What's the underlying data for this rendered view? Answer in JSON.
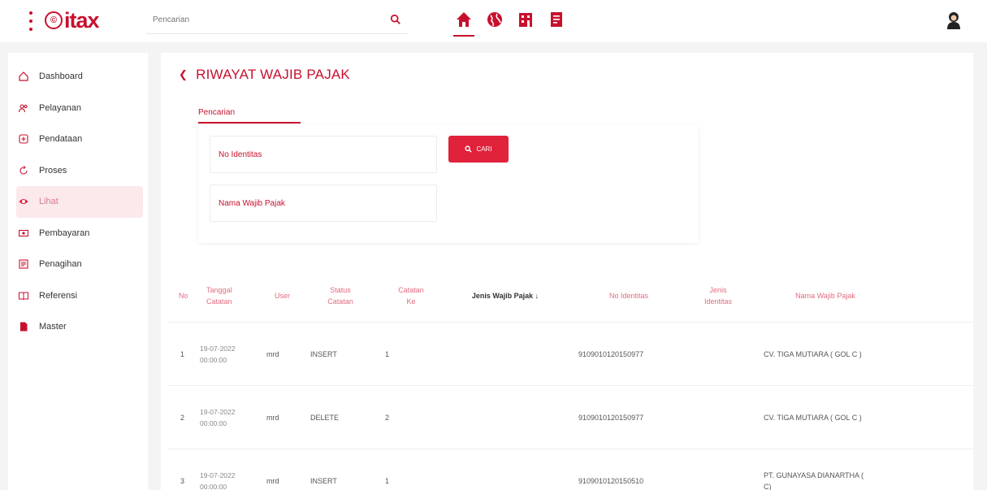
{
  "header": {
    "logo_symbol": "©",
    "logo_text": "itax",
    "search_placeholder": "Pencarian",
    "nav_icons": [
      "home-icon",
      "globe-icon",
      "building-icon",
      "document-icon"
    ],
    "active_nav": "home-icon",
    "avatar_icon": "user-avatar-icon"
  },
  "sidebar": {
    "items": [
      {
        "label": "Dashboard",
        "icon": "home-icon"
      },
      {
        "label": "Pelayanan",
        "icon": "users-icon"
      },
      {
        "label": "Pendataan",
        "icon": "add-box-icon"
      },
      {
        "label": "Proses",
        "icon": "refresh-icon"
      },
      {
        "label": "Lihat",
        "icon": "eye-icon"
      },
      {
        "label": "Pembayaran",
        "icon": "money-icon"
      },
      {
        "label": "Penagihan",
        "icon": "invoice-icon"
      },
      {
        "label": "Referensi",
        "icon": "book-icon"
      },
      {
        "label": "Master",
        "icon": "file-icon"
      }
    ],
    "active_index": 4
  },
  "page": {
    "title": "RIWAYAT WAJIB PAJAK",
    "tab_label": "Pencarian",
    "field_no_identitas": "No Identitas",
    "field_nama": "Nama Wajib Pajak",
    "button_cari": "CARI"
  },
  "table": {
    "headers": {
      "no": "No",
      "tanggal": [
        "Tanggal",
        "Catatan"
      ],
      "user": "User",
      "status": [
        "Status",
        "Catatan"
      ],
      "catatan_ke": [
        "Catatan",
        "Ke"
      ],
      "jenis_wp": "Jenis Wajib Pajak ↓",
      "no_identitas": "No Identitas",
      "jenis_identitas": [
        "Jenis",
        "Identitas"
      ],
      "nama_wp": "Nama Wajib Pajak"
    },
    "rows": [
      {
        "no": "1",
        "tanggal": [
          "19-07-2022",
          "00:00:00"
        ],
        "user": "mrd",
        "status": "INSERT",
        "ke": "1",
        "jenis": "",
        "no_identitas": "9109010120150977",
        "jenis_identitas": "",
        "nama": [
          "CV. TIGA MUTIARA ( GOL C )",
          ""
        ]
      },
      {
        "no": "2",
        "tanggal": [
          "19-07-2022",
          "00:00:00"
        ],
        "user": "mrd",
        "status": "DELETE",
        "ke": "2",
        "jenis": "",
        "no_identitas": "9109010120150977",
        "jenis_identitas": "",
        "nama": [
          "CV. TIGA MUTIARA ( GOL C )",
          ""
        ]
      },
      {
        "no": "3",
        "tanggal": [
          "19-07-2022",
          "00:00:00"
        ],
        "user": "mrd",
        "status": "INSERT",
        "ke": "1",
        "jenis": "",
        "no_identitas": "9109010120150510",
        "jenis_identitas": "",
        "nama": [
          "PT. GUNAYASA DIANARTHA (",
          "C)"
        ]
      }
    ]
  },
  "colors": {
    "brand": "#c8102e",
    "button": "#e0223b",
    "active_sidebar_bg": "#fbe9ec",
    "header_text": "#e06b80"
  }
}
